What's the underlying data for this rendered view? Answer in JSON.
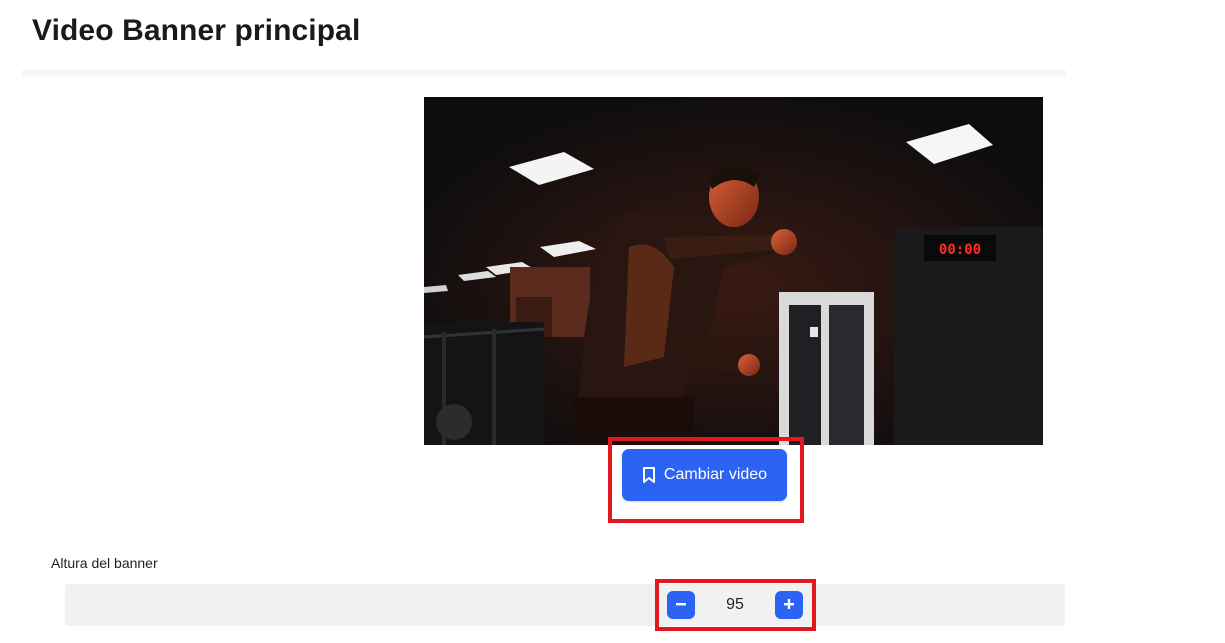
{
  "page": {
    "title": "Video Banner principal"
  },
  "video": {
    "clock_text": "00:00",
    "change_button": {
      "label": "Cambiar video",
      "icon": "bookmark-icon"
    }
  },
  "banner_height": {
    "label": "Altura del banner",
    "value": "95",
    "decrement_icon": "minus-icon",
    "increment_icon": "plus-icon"
  },
  "colors": {
    "primary_button": "#2b63f5",
    "highlight": "#e1191f",
    "stepper_background": "#f1f1f1"
  }
}
